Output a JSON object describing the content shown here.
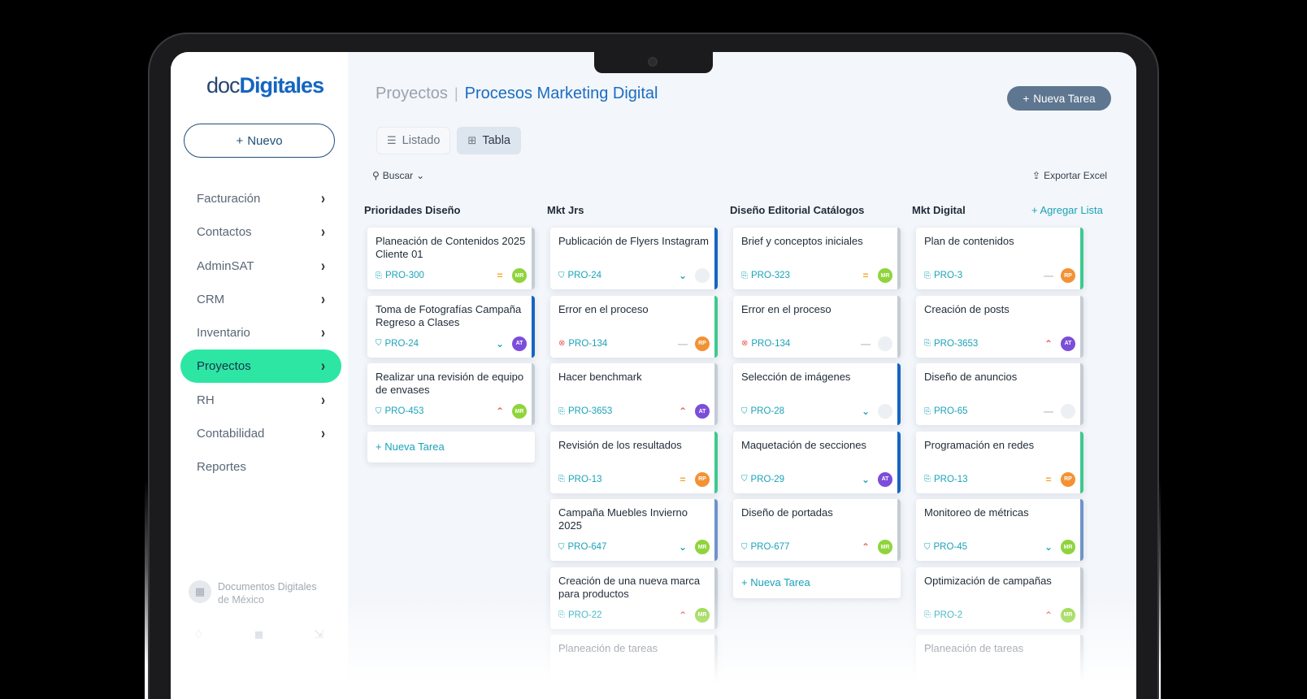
{
  "app": {
    "logo_part1": "doc",
    "logo_part2": "Digitales",
    "new_button": "Nuevo"
  },
  "sidebar": {
    "items": [
      {
        "label": "Facturación",
        "chevron": true,
        "active": false
      },
      {
        "label": "Contactos",
        "chevron": true,
        "active": false
      },
      {
        "label": "AdminSAT",
        "chevron": true,
        "active": false
      },
      {
        "label": "CRM",
        "chevron": true,
        "active": false
      },
      {
        "label": "Inventario",
        "chevron": true,
        "active": false
      },
      {
        "label": "Proyectos",
        "chevron": true,
        "active": true
      },
      {
        "label": "RH",
        "chevron": true,
        "active": false
      },
      {
        "label": "Contabilidad",
        "chevron": true,
        "active": false
      },
      {
        "label": "Reportes",
        "chevron": false,
        "active": false
      }
    ],
    "company_line1": "Documentos Digitales",
    "company_line2": "de México"
  },
  "header": {
    "crumb_parent": "Proyectos",
    "crumb_current": "Procesos Marketing Digital",
    "new_task_button": "Nueva Tarea"
  },
  "tabs": [
    {
      "label": "Listado",
      "icon": "list-icon",
      "active": false
    },
    {
      "label": "Tabla",
      "icon": "table-icon",
      "active": true
    }
  ],
  "toolbar": {
    "search_label": "Buscar",
    "export_label": "Exportar Excel",
    "add_list_label": "+ Agregar Lista",
    "new_task_link": "+ Nueva Tarea"
  },
  "colors": {
    "accent": "#2ee6a3",
    "brand": "#1a6dc2",
    "orange": "#f5a623",
    "blue": "#1565c0",
    "green": "#3ec98f",
    "gray": "#c5ccd4",
    "steel": "#6e94c9"
  },
  "columns": [
    {
      "title": "Prioridades Diseño",
      "show_add": true,
      "cards": [
        {
          "title": "Planeación de Contenidos 2025 Cliente 01",
          "id": "PRO-300",
          "id_icon": "doc",
          "priority": "medium",
          "avatar": "MR",
          "avatar_color": "#8fd43b",
          "bar_color": "#c5ccd4"
        },
        {
          "title": "Toma de Fotografías Campaña Regreso a Clases",
          "id": "PRO-24",
          "id_icon": "check",
          "priority": "low",
          "avatar": "AT",
          "avatar_color": "#7c4dd9",
          "bar_color": "#1565c0"
        },
        {
          "title": "Realizar una revisión de equipo de envases",
          "id": "PRO-453",
          "id_icon": "check",
          "priority": "high",
          "avatar": "MR",
          "avatar_color": "#8fd43b",
          "bar_color": "#c5ccd4"
        }
      ]
    },
    {
      "title": "Mkt Jrs",
      "show_add": false,
      "cards": [
        {
          "title": "Publicación de Flyers Instagram",
          "id": "PRO-24",
          "id_icon": "check",
          "priority": "low",
          "avatar": "",
          "avatar_color": "#eceff3",
          "bar_color": "#1565c0"
        },
        {
          "title": "Error en el proceso",
          "id": "PRO-134",
          "id_icon": "error",
          "priority": "none",
          "avatar": "RP",
          "avatar_color": "#f39234",
          "bar_color": "#3ec98f"
        },
        {
          "title": "Hacer benchmark",
          "id": "PRO-3653",
          "id_icon": "doc",
          "priority": "high",
          "avatar": "AT",
          "avatar_color": "#7c4dd9",
          "bar_color": "#c5ccd4"
        },
        {
          "title": "Revisión de los resultados",
          "id": "PRO-13",
          "id_icon": "doc",
          "priority": "medium",
          "avatar": "RP",
          "avatar_color": "#f39234",
          "bar_color": "#3ec98f"
        },
        {
          "title": "Campaña Muebles Invierno 2025",
          "id": "PRO-647",
          "id_icon": "check",
          "priority": "low",
          "avatar": "MR",
          "avatar_color": "#8fd43b",
          "bar_color": "#6e94c9"
        },
        {
          "title": "Creación de una nueva marca para productos",
          "id": "PRO-22",
          "id_icon": "doc",
          "priority": "high",
          "avatar": "MR",
          "avatar_color": "#8fd43b",
          "bar_color": "#c5ccd4"
        },
        {
          "title": "Planeación de tareas",
          "id": "",
          "id_icon": "doc",
          "priority": "none",
          "avatar": "",
          "avatar_color": "#eceff3",
          "bar_color": "#c5ccd4"
        }
      ]
    },
    {
      "title": "Diseño Editorial Catálogos",
      "show_add": true,
      "cards": [
        {
          "title": "Brief y conceptos iniciales",
          "id": "PRO-323",
          "id_icon": "doc",
          "priority": "medium",
          "avatar": "MR",
          "avatar_color": "#8fd43b",
          "bar_color": "#c5ccd4"
        },
        {
          "title": "Error en el proceso",
          "id": "PRO-134",
          "id_icon": "error",
          "priority": "none",
          "avatar": "",
          "avatar_color": "#eceff3",
          "bar_color": "#c5ccd4"
        },
        {
          "title": "Selección de imágenes",
          "id": "PRO-28",
          "id_icon": "check",
          "priority": "low",
          "avatar": "",
          "avatar_color": "#eceff3",
          "bar_color": "#1565c0"
        },
        {
          "title": "Maquetación de secciones",
          "id": "PRO-29",
          "id_icon": "check",
          "priority": "low",
          "avatar": "AT",
          "avatar_color": "#7c4dd9",
          "bar_color": "#1565c0"
        },
        {
          "title": "Diseño de portadas",
          "id": "PRO-677",
          "id_icon": "check",
          "priority": "high",
          "avatar": "MR",
          "avatar_color": "#8fd43b",
          "bar_color": "#c5ccd4"
        }
      ]
    },
    {
      "title": "Mkt Digital",
      "show_add": false,
      "cards": [
        {
          "title": "Plan de contenidos",
          "id": "PRO-3",
          "id_icon": "doc",
          "priority": "none",
          "avatar": "RP",
          "avatar_color": "#f39234",
          "bar_color": "#3ec98f"
        },
        {
          "title": "Creación de posts",
          "id": "PRO-3653",
          "id_icon": "doc",
          "priority": "high",
          "avatar": "AT",
          "avatar_color": "#7c4dd9",
          "bar_color": "#c5ccd4"
        },
        {
          "title": "Diseño de anuncios",
          "id": "PRO-65",
          "id_icon": "doc",
          "priority": "none",
          "avatar": "",
          "avatar_color": "#eceff3",
          "bar_color": "#c5ccd4"
        },
        {
          "title": "Programación en redes",
          "id": "PRO-13",
          "id_icon": "doc",
          "priority": "medium",
          "avatar": "RP",
          "avatar_color": "#f39234",
          "bar_color": "#3ec98f"
        },
        {
          "title": "Monitoreo de métricas",
          "id": "PRO-45",
          "id_icon": "check",
          "priority": "low",
          "avatar": "MR",
          "avatar_color": "#8fd43b",
          "bar_color": "#6e94c9"
        },
        {
          "title": "Optimización de campañas",
          "id": "PRO-2",
          "id_icon": "doc",
          "priority": "high",
          "avatar": "MR",
          "avatar_color": "#8fd43b",
          "bar_color": "#c5ccd4"
        },
        {
          "title": "Planeación de tareas",
          "id": "",
          "id_icon": "doc",
          "priority": "none",
          "avatar": "",
          "avatar_color": "#eceff3",
          "bar_color": "#c5ccd4"
        }
      ]
    }
  ]
}
